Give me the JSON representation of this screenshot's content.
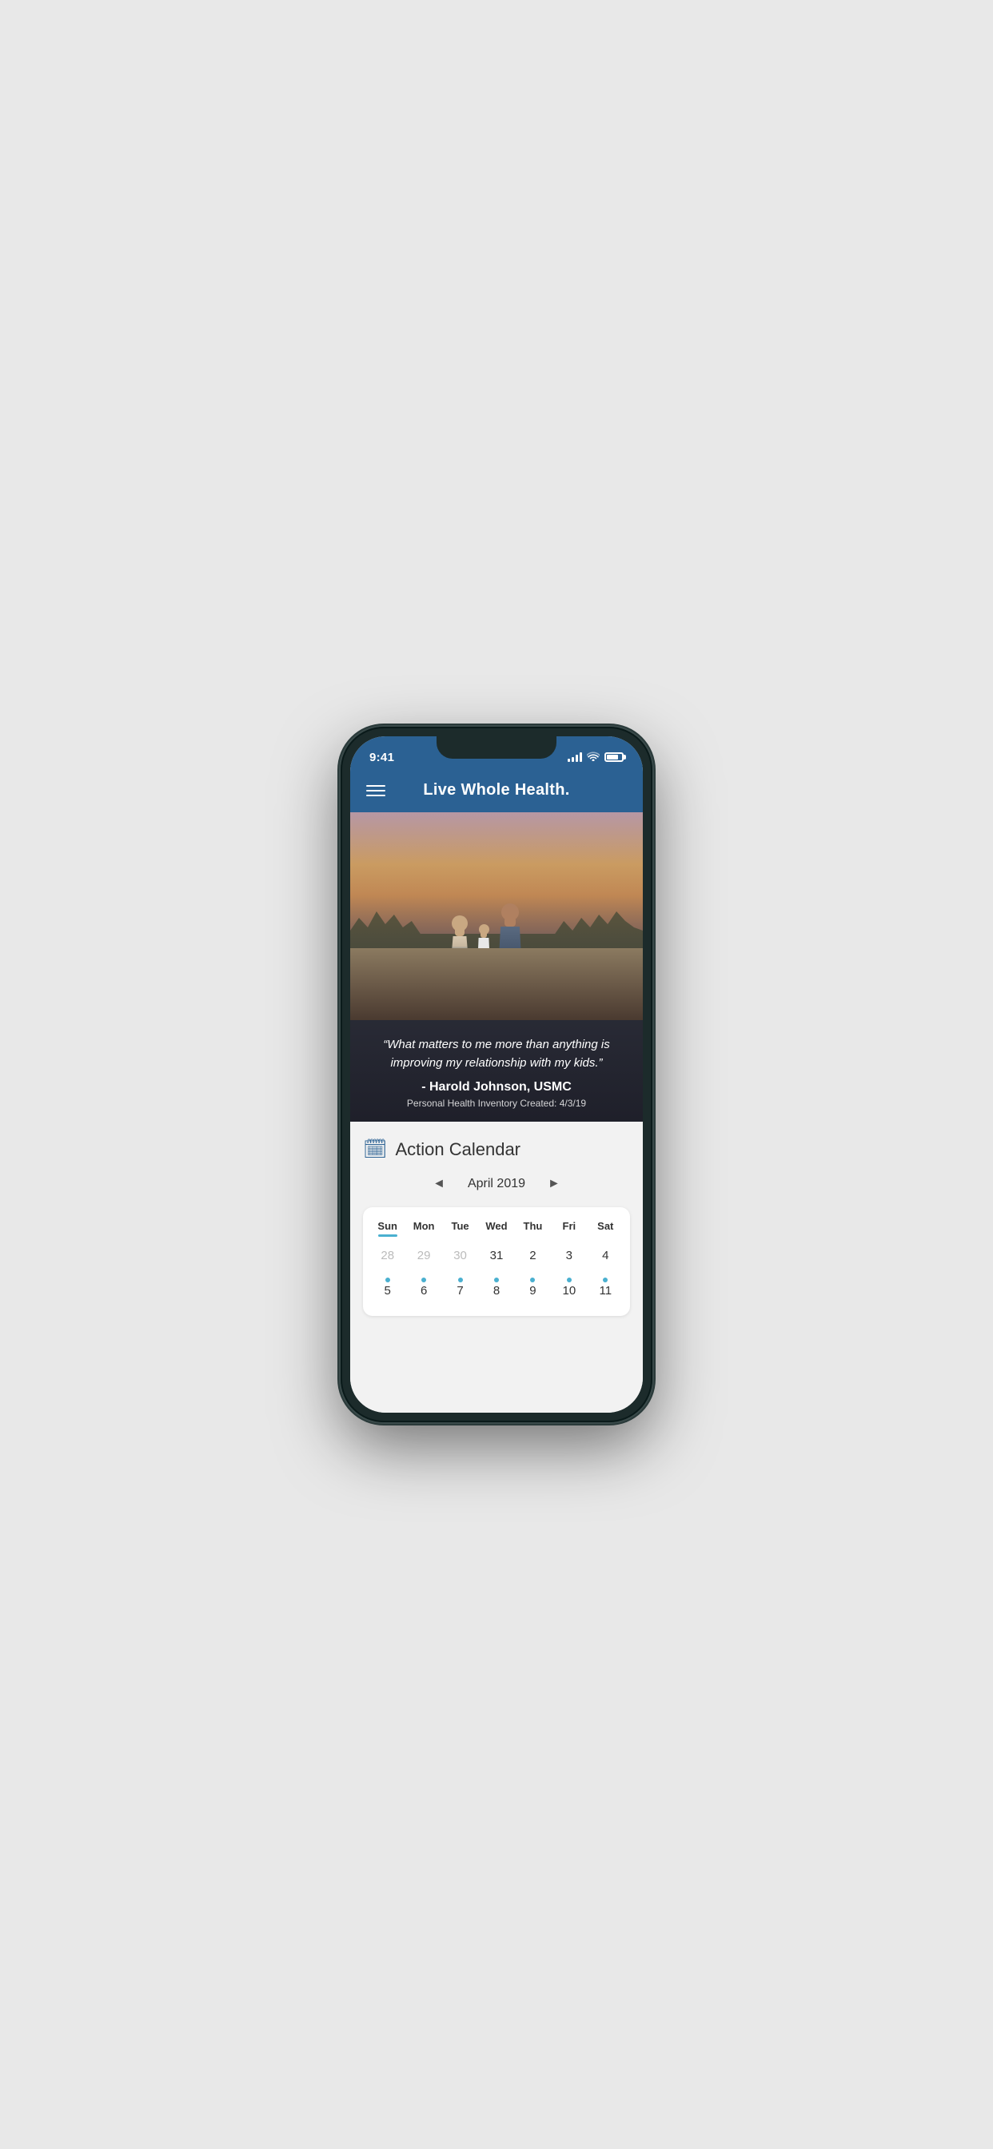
{
  "status": {
    "time": "9:41"
  },
  "header": {
    "title": "Live Whole Health."
  },
  "quote": {
    "text": "“What matters to me more than anything is improving my relationship with my kids.”",
    "author": "- Harold Johnson, USMC",
    "subtitle": "Personal Health Inventory Created: 4/3/19"
  },
  "calendar": {
    "icon": "📅",
    "title": "Action Calendar",
    "month_label": "April 2019",
    "prev_arrow": "◄",
    "next_arrow": "►",
    "day_headers": [
      "Sun",
      "Mon",
      "Tue",
      "Wed",
      "Thu",
      "Fri",
      "Sat"
    ],
    "active_day_index": 0,
    "rows": [
      {
        "cells": [
          {
            "num": "28",
            "inactive": true,
            "dot": false
          },
          {
            "num": "29",
            "inactive": true,
            "dot": false
          },
          {
            "num": "30",
            "inactive": true,
            "dot": false
          },
          {
            "num": "31",
            "inactive": false,
            "dot": false
          },
          {
            "num": "2",
            "inactive": false,
            "dot": false
          },
          {
            "num": "3",
            "inactive": false,
            "dot": false
          },
          {
            "num": "4",
            "inactive": false,
            "dot": false
          }
        ]
      },
      {
        "cells": [
          {
            "num": "5",
            "inactive": false,
            "dot": true
          },
          {
            "num": "6",
            "inactive": false,
            "dot": true
          },
          {
            "num": "7",
            "inactive": false,
            "dot": true
          },
          {
            "num": "8",
            "inactive": false,
            "dot": true
          },
          {
            "num": "9",
            "inactive": false,
            "dot": true
          },
          {
            "num": "10",
            "inactive": false,
            "dot": true
          },
          {
            "num": "11",
            "inactive": false,
            "dot": true
          }
        ]
      }
    ]
  }
}
